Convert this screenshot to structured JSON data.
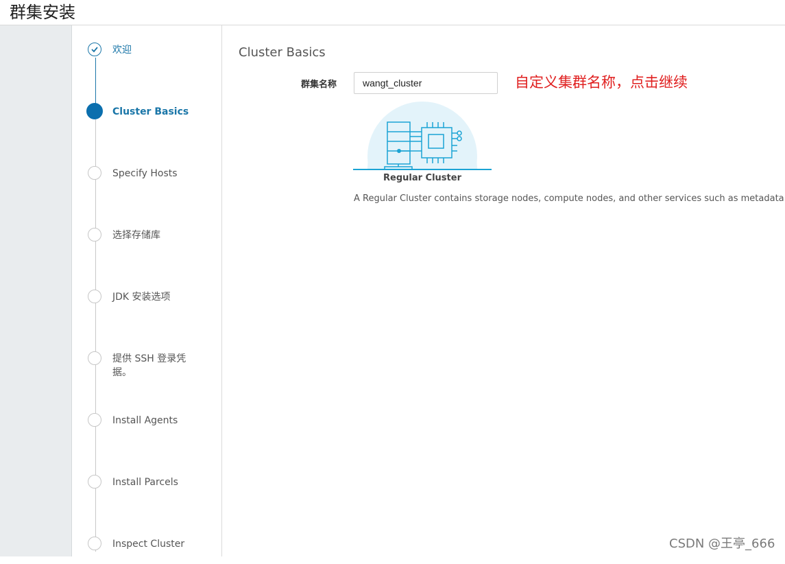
{
  "page": {
    "title": "群集安装"
  },
  "wizard": {
    "steps": [
      {
        "label": "欢迎",
        "state": "complete"
      },
      {
        "label": "Cluster Basics",
        "state": "active"
      },
      {
        "label": "Specify Hosts",
        "state": "pending"
      },
      {
        "label": "选择存储库",
        "state": "pending"
      },
      {
        "label": "JDK 安装选项",
        "state": "pending"
      },
      {
        "label": "提供 SSH 登录凭据。",
        "state": "pending"
      },
      {
        "label": "Install Agents",
        "state": "pending"
      },
      {
        "label": "Install Parcels",
        "state": "pending"
      },
      {
        "label": "Inspect Cluster",
        "state": "pending"
      }
    ]
  },
  "main": {
    "section_title": "Cluster Basics",
    "cluster_name_label": "群集名称",
    "cluster_name_value": "wangt_cluster",
    "annotation": "自定义集群名称，点击继续",
    "cluster_type": {
      "label": "Regular Cluster",
      "description": "A Regular Cluster contains storage nodes, compute nodes, and other services such as metadata and s"
    }
  },
  "watermark": "CSDN @王亭_666",
  "colors": {
    "accent": "#0b6fae",
    "annotation": "#e02020",
    "illustration": "#1aa3d4",
    "illustration_bg": "#e3f3fa"
  }
}
